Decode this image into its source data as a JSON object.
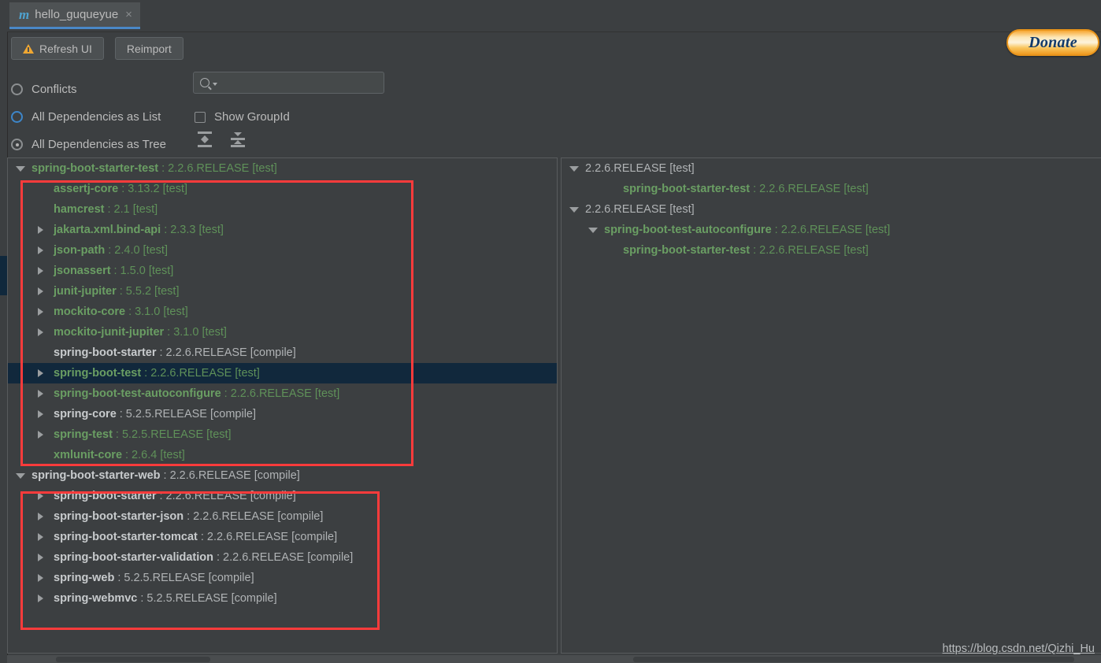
{
  "window": {
    "tab": {
      "icon": "maven-m-icon",
      "title": "hello_guqueyue",
      "close": "×"
    }
  },
  "toolbar": {
    "refresh_label": "Refresh UI",
    "reimport_label": "Reimport",
    "donate_label": "Donate"
  },
  "options": {
    "conflicts_label": "Conflicts",
    "list_label": "All Dependencies as List",
    "tree_label": "All Dependencies as Tree",
    "show_groupid_label": "Show GroupId",
    "search_placeholder": "",
    "search_value": "",
    "expand_all_title": "Expand All",
    "collapse_all_title": "Collapse All"
  },
  "left_tree": [
    {
      "indent": 0,
      "toggle": "down",
      "name": "spring-boot-starter-test",
      "sep": ":",
      "version": "2.2.6.RELEASE [test]",
      "scope": "test",
      "selected": false
    },
    {
      "indent": 1,
      "toggle": "none",
      "name": "assertj-core",
      "sep": ":",
      "version": "3.13.2 [test]",
      "scope": "test",
      "selected": false
    },
    {
      "indent": 1,
      "toggle": "none",
      "name": "hamcrest",
      "sep": ":",
      "version": "2.1 [test]",
      "scope": "test",
      "selected": false
    },
    {
      "indent": 1,
      "toggle": "right",
      "name": "jakarta.xml.bind-api",
      "sep": ":",
      "version": "2.3.3 [test]",
      "scope": "test",
      "selected": false
    },
    {
      "indent": 1,
      "toggle": "right",
      "name": "json-path",
      "sep": ":",
      "version": "2.4.0 [test]",
      "scope": "test",
      "selected": false
    },
    {
      "indent": 1,
      "toggle": "right",
      "name": "jsonassert",
      "sep": ":",
      "version": "1.5.0 [test]",
      "scope": "test",
      "selected": false
    },
    {
      "indent": 1,
      "toggle": "right",
      "name": "junit-jupiter",
      "sep": ":",
      "version": "5.5.2 [test]",
      "scope": "test",
      "selected": false
    },
    {
      "indent": 1,
      "toggle": "right",
      "name": "mockito-core",
      "sep": ":",
      "version": "3.1.0 [test]",
      "scope": "test",
      "selected": false
    },
    {
      "indent": 1,
      "toggle": "right",
      "name": "mockito-junit-jupiter",
      "sep": ":",
      "version": "3.1.0 [test]",
      "scope": "test",
      "selected": false
    },
    {
      "indent": 1,
      "toggle": "none",
      "name": "spring-boot-starter",
      "sep": ":",
      "version": "2.2.6.RELEASE [compile]",
      "scope": "compile",
      "selected": false
    },
    {
      "indent": 1,
      "toggle": "right",
      "name": "spring-boot-test",
      "sep": ":",
      "version": "2.2.6.RELEASE [test]",
      "scope": "test",
      "selected": true
    },
    {
      "indent": 1,
      "toggle": "right",
      "name": "spring-boot-test-autoconfigure",
      "sep": ":",
      "version": "2.2.6.RELEASE [test]",
      "scope": "test",
      "selected": false
    },
    {
      "indent": 1,
      "toggle": "right",
      "name": "spring-core",
      "sep": ":",
      "version": "5.2.5.RELEASE [compile]",
      "scope": "compile",
      "selected": false
    },
    {
      "indent": 1,
      "toggle": "right",
      "name": "spring-test",
      "sep": ":",
      "version": "5.2.5.RELEASE [test]",
      "scope": "test",
      "selected": false
    },
    {
      "indent": 1,
      "toggle": "none",
      "name": "xmlunit-core",
      "sep": ":",
      "version": "2.6.4 [test]",
      "scope": "test",
      "selected": false
    },
    {
      "indent": 0,
      "toggle": "down",
      "name": "spring-boot-starter-web",
      "sep": ":",
      "version": "2.2.6.RELEASE [compile]",
      "scope": "compile",
      "selected": false
    },
    {
      "indent": 1,
      "toggle": "right",
      "name": "spring-boot-starter",
      "sep": ":",
      "version": "2.2.6.RELEASE [compile]",
      "scope": "compile",
      "selected": false
    },
    {
      "indent": 1,
      "toggle": "right",
      "name": "spring-boot-starter-json",
      "sep": ":",
      "version": "2.2.6.RELEASE [compile]",
      "scope": "compile",
      "selected": false
    },
    {
      "indent": 1,
      "toggle": "right",
      "name": "spring-boot-starter-tomcat",
      "sep": ":",
      "version": "2.2.6.RELEASE [compile]",
      "scope": "compile",
      "selected": false
    },
    {
      "indent": 1,
      "toggle": "right",
      "name": "spring-boot-starter-validation",
      "sep": ":",
      "version": "2.2.6.RELEASE [compile]",
      "scope": "compile",
      "selected": false
    },
    {
      "indent": 1,
      "toggle": "right",
      "name": "spring-web",
      "sep": ":",
      "version": "5.2.5.RELEASE [compile]",
      "scope": "compile",
      "selected": false
    },
    {
      "indent": 1,
      "toggle": "right",
      "name": "spring-webmvc",
      "sep": ":",
      "version": "5.2.5.RELEASE [compile]",
      "scope": "compile",
      "selected": false
    }
  ],
  "right_tree": [
    {
      "indent": 0,
      "toggle": "down",
      "name": "",
      "sep": "",
      "version": "2.2.6.RELEASE [test]",
      "scope": "plain",
      "selected": false
    },
    {
      "indent": 2,
      "toggle": "none",
      "name": "spring-boot-starter-test",
      "sep": ":",
      "version": "2.2.6.RELEASE [test]",
      "scope": "test",
      "selected": false
    },
    {
      "indent": 0,
      "toggle": "down",
      "name": "",
      "sep": "",
      "version": "2.2.6.RELEASE [test]",
      "scope": "plain",
      "selected": false
    },
    {
      "indent": 1,
      "toggle": "down",
      "name": "spring-boot-test-autoconfigure",
      "sep": ":",
      "version": "2.2.6.RELEASE [test]",
      "scope": "test",
      "selected": false
    },
    {
      "indent": 2,
      "toggle": "none",
      "name": "spring-boot-starter-test",
      "sep": ":",
      "version": "2.2.6.RELEASE [test]",
      "scope": "test",
      "selected": false
    }
  ],
  "annotations": {
    "redbox_test_label": "highlight-test-dependencies",
    "redbox_web_label": "highlight-web-dependencies",
    "accent_red": "#fc3b3b",
    "accent_blue": "#4a88c7",
    "scope_test_color": "#6a9e63",
    "scope_compile_color": "#c8cbcd"
  },
  "watermark": {
    "text": "https://blog.csdn.net/Qizhi_Hu"
  }
}
